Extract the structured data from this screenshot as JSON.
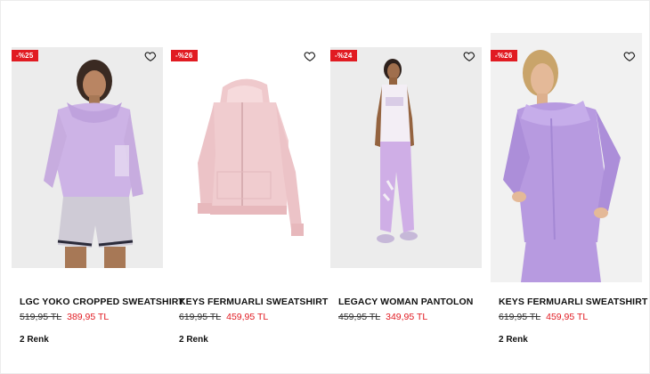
{
  "products": [
    {
      "discount": "-%25",
      "name": "LGC YOKO CROPPED SWEATSHIRT",
      "old_price": "519,95 TL",
      "price": "389,95 TL",
      "colors": "2 Renk",
      "image": "woman-in-lilac-cropped-hoodie-and-grey-shorts"
    },
    {
      "discount": "-%26",
      "name": "KEYS FERMUARLI SWEATSHIRT",
      "old_price": "619,95 TL",
      "price": "459,95 TL",
      "colors": "2 Renk",
      "image": "pink-zip-hoodie-flat"
    },
    {
      "discount": "-%24",
      "name": "LEGACY WOMAN PANTOLON",
      "old_price": "459,95 TL",
      "price": "349,95 TL",
      "colors": "",
      "image": "woman-in-white-tank-and-lilac-joggers"
    },
    {
      "discount": "-%26",
      "name": "KEYS FERMUARLI SWEATSHIRT",
      "old_price": "619,95 TL",
      "price": "459,95 TL",
      "colors": "2 Renk",
      "image": "woman-in-lilac-zip-hoodie"
    }
  ],
  "icons": {
    "favorite": "heart-outline-icon"
  },
  "colors": {
    "badge": "#e11b22",
    "sale_price": "#e11b22"
  }
}
